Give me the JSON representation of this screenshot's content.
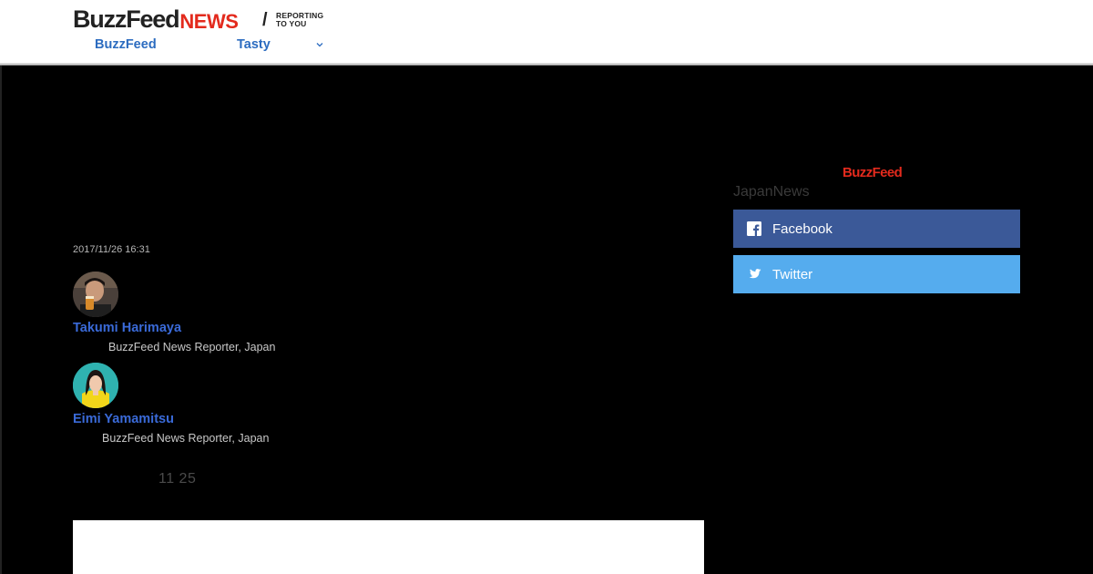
{
  "header": {
    "logo_buzzfeed": "BuzzFeed",
    "logo_news": "NEWS",
    "logo_slash": "/",
    "logo_tagline_line1": "REPORTING",
    "logo_tagline_line2": "TO YOU",
    "nav": [
      {
        "label": "BuzzFeed"
      },
      {
        "label": "Tasty"
      }
    ],
    "nav_more_icon": "chevron-down-icon"
  },
  "article": {
    "timestamp": "2017/11/26 16:31",
    "authors": [
      {
        "name": "Takumi Harimaya",
        "title": "BuzzFeed News Reporter, Japan"
      },
      {
        "name": "Eimi Yamamitsu",
        "title": "BuzzFeed News Reporter, Japan"
      }
    ],
    "date_text": "11  25"
  },
  "sidebar": {
    "logo": "BuzzFeed",
    "label": "JapanNews",
    "share": [
      {
        "label": "Facebook",
        "icon": "facebook-icon",
        "color": "#3b5998"
      },
      {
        "label": "Twitter",
        "icon": "twitter-icon",
        "color": "#55acee"
      }
    ]
  },
  "colors": {
    "brand_red": "#e32a1d",
    "link_blue": "#2c6cc0",
    "author_blue": "#3a6ad8"
  }
}
